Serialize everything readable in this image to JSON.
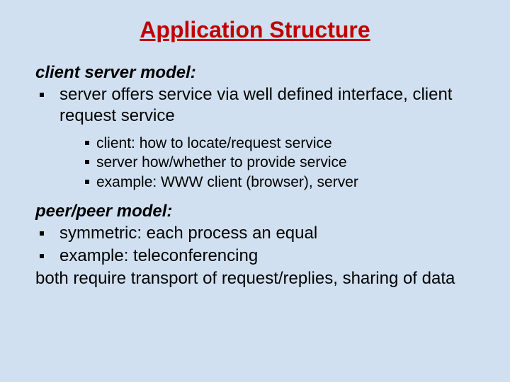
{
  "title": "Application Structure",
  "section1": {
    "heading": "client server model:",
    "bullet": "server offers service via well defined interface, client request service",
    "subs": {
      "s0": "client: how to locate/request service",
      "s1": "server how/whether to provide service",
      "s2": "example: WWW client (browser), server"
    }
  },
  "section2": {
    "heading": "peer/peer model:",
    "bullets": {
      "b0": "symmetric: each process an equal",
      "b1": "example: teleconferencing"
    }
  },
  "closing": "both require transport of request/replies, sharing of data"
}
